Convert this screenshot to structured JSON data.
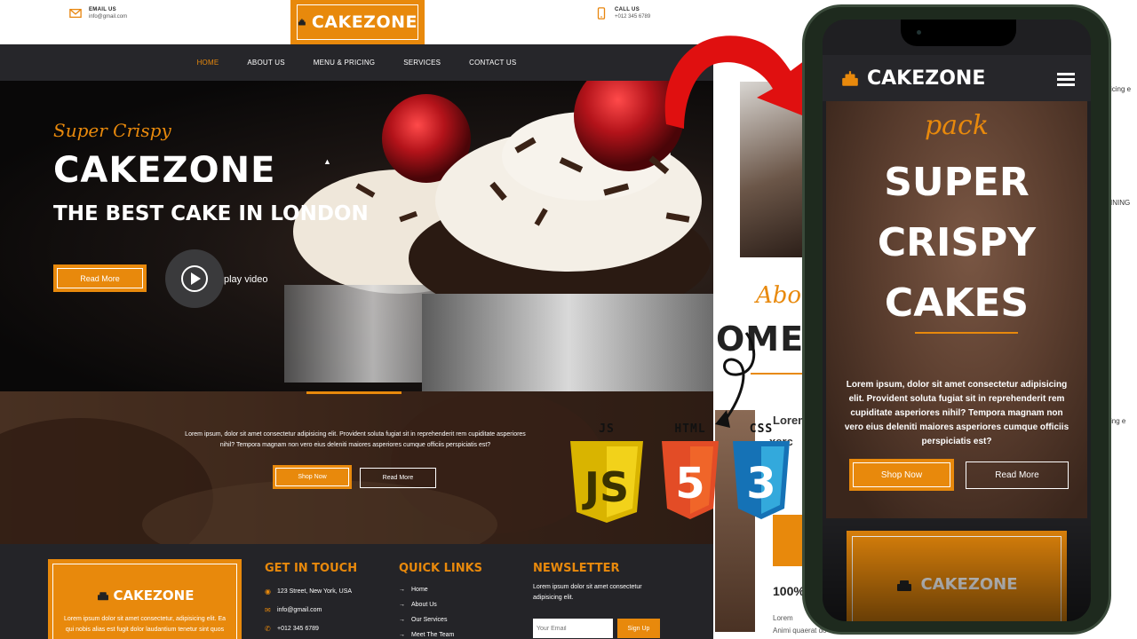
{
  "desktop": {
    "topbar": {
      "email_label": "EMAIL US",
      "email_value": "info@gmail.com",
      "call_label": "CALL US",
      "call_value": "+012 345 6789",
      "logo": "CAKEZONE"
    },
    "nav": {
      "items": [
        {
          "label": "HOME"
        },
        {
          "label": "ABOUT US"
        },
        {
          "label": "MENU & PRICING"
        },
        {
          "label": "SERVICES"
        },
        {
          "label": "CONTACT US"
        }
      ]
    },
    "hero": {
      "subtitle": "Super Crispy",
      "title": "CAKEZONE",
      "tagline": "THE BEST CAKE IN LONDON",
      "read_more": "Read More",
      "play_label": "play video"
    },
    "banner": {
      "text": "Lorem ipsum, dolor sit amet consectetur adipisicing elit. Provident soluta fugiat sit in reprehenderit rem cupiditate asperiores nihil? Tempora magnam non vero eius deleniti maiores asperiores cumque officiis perspiciatis est?",
      "shop_now": "Shop Now",
      "read_more": "Read More"
    },
    "footer": {
      "logo": "CAKEZONE",
      "logo_desc": "Lorem ipsum dolor sit amet consectetur, adipisicing elit. Ea qui nobis alias est fugit dolor laudantium tenetur sint quos",
      "get_in_touch": {
        "title": "GET IN TOUCH",
        "address": "123 Street, New York, USA",
        "email": "info@gmail.com",
        "phone": "+012 345 6789"
      },
      "quick_links": {
        "title": "QUICK LINKS",
        "links": [
          "Home",
          "About Us",
          "Our Services",
          "Meet The Team"
        ]
      },
      "newsletter": {
        "title": "NEWSLETTER",
        "text": "Lorem ipsum dolor sit amet consectetur adipisicing elit.",
        "placeholder": "Your Email",
        "button": "Sign Up"
      }
    }
  },
  "tech": {
    "js": "JS",
    "html": "HTML",
    "css": "CSS",
    "js_badge": "JS",
    "html_badge": "5",
    "css_badge": "3"
  },
  "background_page": {
    "about": "Abou",
    "big_title": "OME TO",
    "lorem_1": "Lorem",
    "lorem_2": "xerc",
    "hundred": "100%",
    "lorem_3": "Lorem",
    "lorem_4": "Animi quaerat do",
    "right_1": "icing e",
    "right_2": "INING",
    "right_3": "ing e"
  },
  "phone": {
    "logo": "CAKEZONE",
    "pack": "pack",
    "big_lines": [
      "SUPER",
      "CRISPY",
      "CAKES"
    ],
    "paragraph": "Lorem ipsum, dolor sit amet consectetur adipisicing elit. Provident soluta fugiat sit in reprehenderit rem cupiditate asperiores nihil? Tempora magnam non vero eius deleniti maiores asperiores cumque officiis perspiciatis est?",
    "shop_now": "Shop Now",
    "read_more": "Read More",
    "card_logo": "CAKEZONE"
  },
  "colors": {
    "accent": "#E8890C",
    "dark": "#26262a",
    "arrow_red": "#E01010"
  }
}
